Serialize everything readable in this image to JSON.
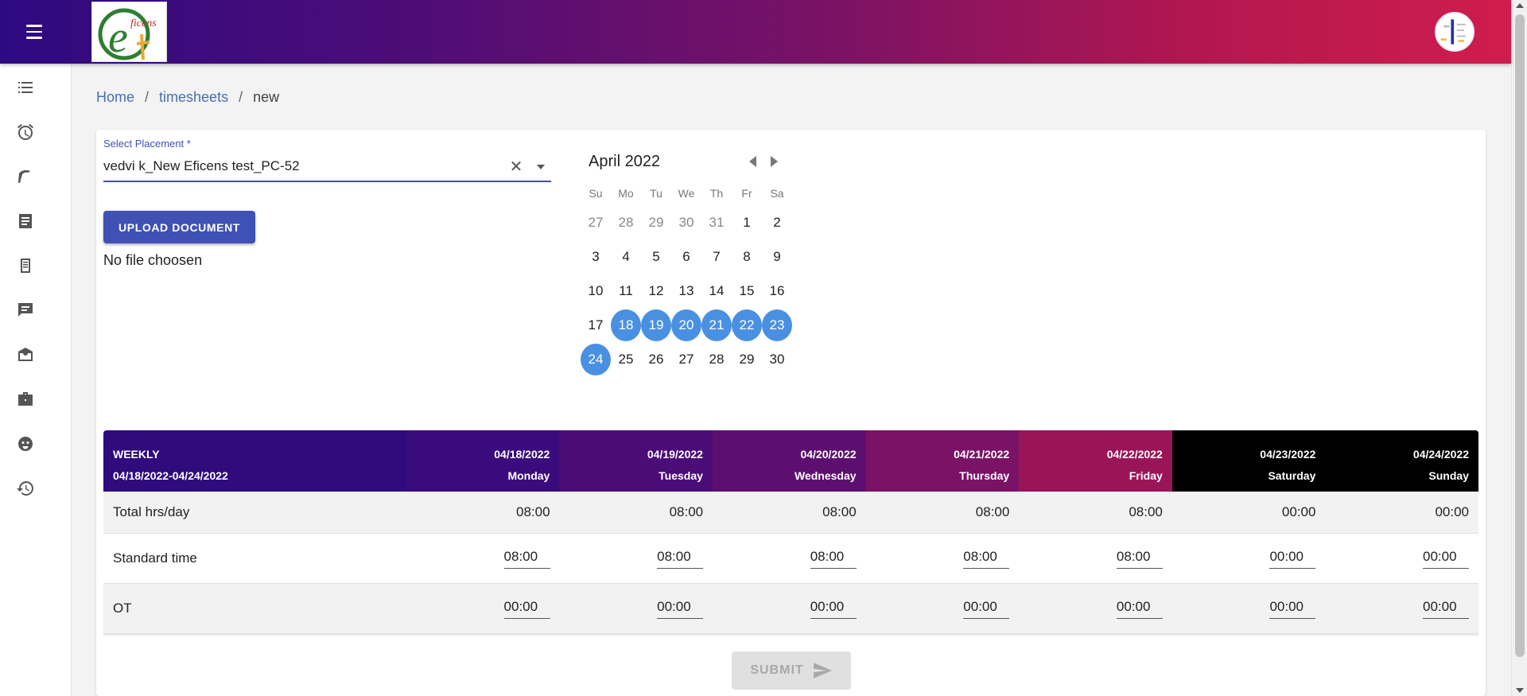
{
  "header": {
    "menu_icon": "hamburger-menu-icon",
    "logo_text": "eficens",
    "gradient_colors": [
      "#2e0a80",
      "#7a1265",
      "#cf1d4d"
    ]
  },
  "sidebar": {
    "items": [
      {
        "icon": "checklist-icon"
      },
      {
        "icon": "alarm-clock-icon"
      },
      {
        "icon": "tool-icon"
      },
      {
        "icon": "document-list-icon"
      },
      {
        "icon": "note-icon"
      },
      {
        "icon": "chat-icon"
      },
      {
        "icon": "inbox-icon"
      },
      {
        "icon": "briefcase-icon"
      },
      {
        "icon": "face-icon"
      },
      {
        "icon": "history-icon"
      }
    ]
  },
  "breadcrumb": {
    "home": "Home",
    "sep1": "/",
    "timesheets": "timesheets",
    "sep2": "/",
    "current": "new"
  },
  "placement": {
    "label": "Select Placement *",
    "value": "vedvi k_New Eficens test_PC-52",
    "clear": "✕"
  },
  "upload": {
    "button_label": "UPLOAD DOCUMENT",
    "file_status": "No file choosen"
  },
  "calendar": {
    "title": "April 2022",
    "weekdays": [
      "Su",
      "Mo",
      "Tu",
      "We",
      "Th",
      "Fr",
      "Sa"
    ],
    "weeks": [
      [
        "27",
        "28",
        "29",
        "30",
        "31",
        "1",
        "2"
      ],
      [
        "3",
        "4",
        "5",
        "6",
        "7",
        "8",
        "9"
      ],
      [
        "10",
        "11",
        "12",
        "13",
        "14",
        "15",
        "16"
      ],
      [
        "17",
        "18",
        "19",
        "20",
        "21",
        "22",
        "23"
      ],
      [
        "24",
        "25",
        "26",
        "27",
        "28",
        "29",
        "30"
      ]
    ],
    "muted": [
      [
        0,
        0
      ],
      [
        0,
        1
      ],
      [
        0,
        2
      ],
      [
        0,
        3
      ],
      [
        0,
        4
      ]
    ],
    "selected": [
      [
        3,
        1
      ],
      [
        3,
        2
      ],
      [
        3,
        3
      ],
      [
        3,
        4
      ],
      [
        3,
        5
      ],
      [
        3,
        6
      ],
      [
        4,
        0
      ]
    ],
    "selected_color": "#4a90e2"
  },
  "table": {
    "weekly_label": "WEEKLY",
    "weekly_range": "04/18/2022-04/24/2022",
    "days": [
      {
        "date": "04/18/2022",
        "name": "Monday",
        "bg": "#3a0b7c"
      },
      {
        "date": "04/19/2022",
        "name": "Tuesday",
        "bg": "#4a0c77"
      },
      {
        "date": "04/20/2022",
        "name": "Wednesday",
        "bg": "#5d0f70"
      },
      {
        "date": "04/21/2022",
        "name": "Thursday",
        "bg": "#7a1266"
      },
      {
        "date": "04/22/2022",
        "name": "Friday",
        "bg": "#9a1558"
      },
      {
        "date": "04/23/2022",
        "name": "Saturday",
        "bg": "#000000"
      },
      {
        "date": "04/24/2022",
        "name": "Sunday",
        "bg": "#000000"
      }
    ],
    "rows": {
      "total": {
        "label": "Total hrs/day",
        "values": [
          "08:00",
          "08:00",
          "08:00",
          "08:00",
          "08:00",
          "00:00",
          "00:00"
        ]
      },
      "standard": {
        "label": "Standard time",
        "values": [
          "08:00",
          "08:00",
          "08:00",
          "08:00",
          "08:00",
          "00:00",
          "00:00"
        ]
      },
      "ot": {
        "label": "OT",
        "values": [
          "00:00",
          "00:00",
          "00:00",
          "00:00",
          "00:00",
          "00:00",
          "00:00"
        ]
      }
    }
  },
  "submit": {
    "label": "SUBMIT",
    "icon": "send-icon"
  }
}
